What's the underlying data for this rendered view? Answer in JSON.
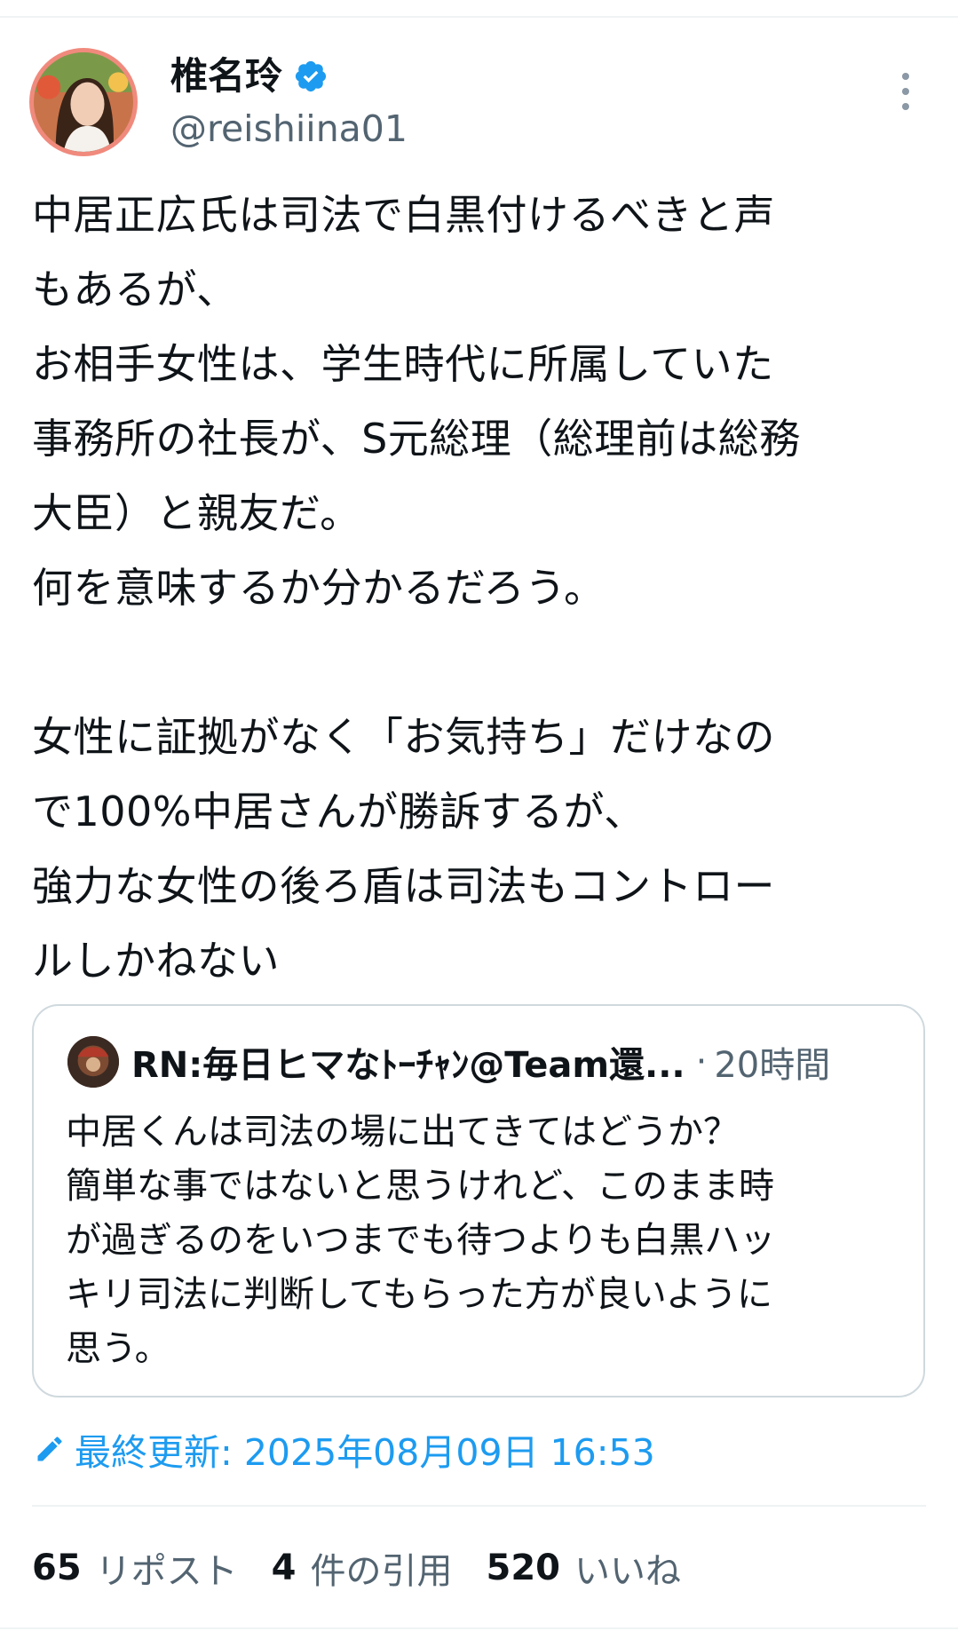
{
  "author": {
    "display_name": "椎名玲",
    "handle": "@reishiina01",
    "verified_color": "#1d9bf0",
    "avatar": "user-avatar"
  },
  "tweet": {
    "lines": [
      "中居正広氏は司法で白黒付けるべきと声",
      "もあるが、",
      "お相手女性は、学生時代に所属していた",
      "事務所の社長が、S元総理（総理前は総務",
      "大臣）と親友だ。",
      "何を意味するか分かるだろう。",
      "",
      "女性に証拠がなく「お気持ち」だけなの",
      "で100%中居さんが勝訴するが、",
      "強力な女性の後ろ盾は司法もコントロー",
      "ルしかねない"
    ]
  },
  "quote": {
    "name": "RN:毎日ヒマなﾄｰﾁｬﾝ@Team還...",
    "separator": "·",
    "time": "20時間",
    "lines": [
      "中居くんは司法の場に出てきてはどうか？",
      "簡単な事ではないと思うけれど、このまま時",
      "が過ぎるのをいつまでも待つよりも白黒ハッ",
      "キリ司法に判断してもらった方が良いように",
      "思う。"
    ]
  },
  "edited": {
    "text": "最終更新: 2025年08月09日 16:53",
    "icon": "pencil-icon"
  },
  "stats": {
    "reposts_count": "65",
    "reposts_label": "リポスト",
    "quotes_count": "4",
    "quotes_label": "件の引用",
    "likes_count": "520",
    "likes_label": "いいね"
  },
  "colors": {
    "accent": "#1d9bf0",
    "secondary_text": "#536471",
    "border": "#cfd9de"
  }
}
